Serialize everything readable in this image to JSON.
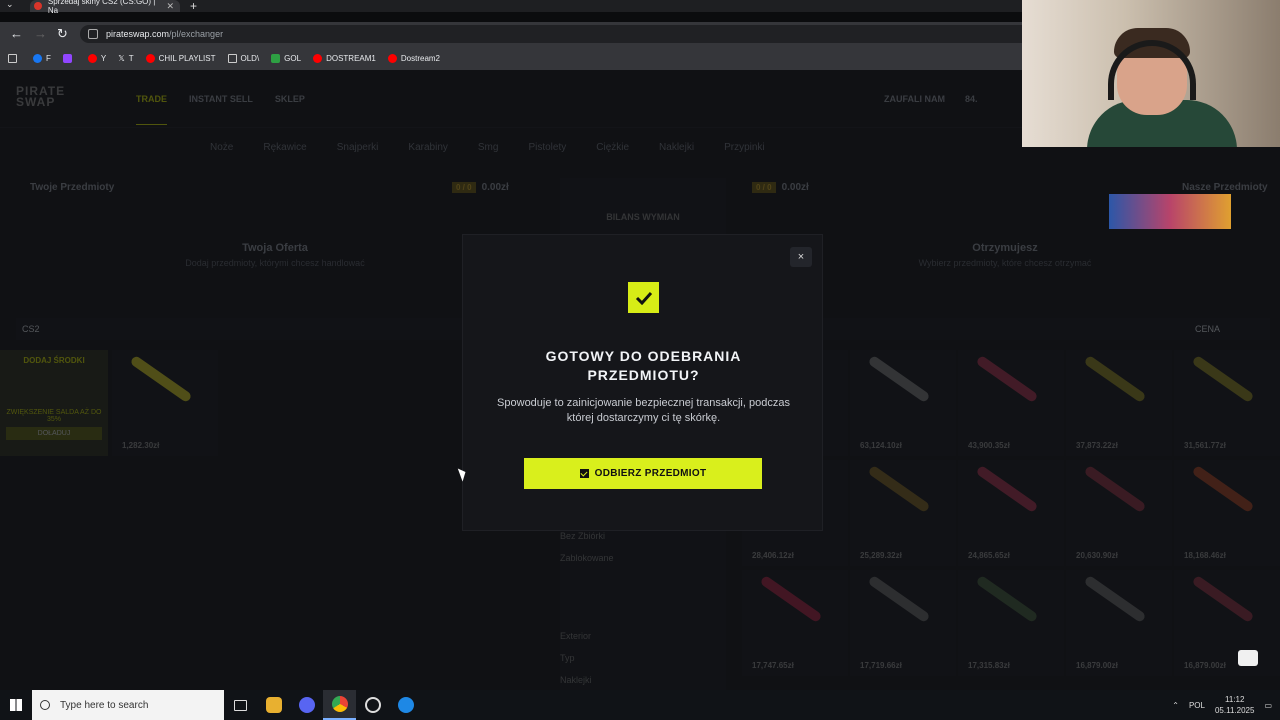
{
  "browser": {
    "tab_title": "Sprzedaj skiny CS2 (CS:GO) | Na",
    "new_tab": "+",
    "url_host": "pirateswap.com",
    "url_path": "/pl/exchanger",
    "bookmarks": [
      {
        "label": "F",
        "color": "#1877f2"
      },
      {
        "label": "",
        "color": "#9146ff"
      },
      {
        "label": "Y",
        "color": "#ff0000"
      },
      {
        "label": "T",
        "color": "#ffffff"
      },
      {
        "label": "CHIL PLAYLIST",
        "color": "#ff0000"
      },
      {
        "label": "OLD\\",
        "color": "#888888"
      },
      {
        "label": "GOL",
        "color": "#2ea043"
      },
      {
        "label": "DOSTREAM1",
        "color": "#ff0000"
      },
      {
        "label": "Dostream2",
        "color": "#ff0000"
      }
    ]
  },
  "site": {
    "logo": "PIRATE SWAP",
    "nav": [
      "TRADE",
      "INSTANT SELL",
      "SKLEP"
    ],
    "nav_right": [
      "ZAUFALI NAM",
      "84."
    ],
    "categories": [
      "Noże",
      "Rękawice",
      "Snajperki",
      "Karabiny",
      "Smg",
      "Pistolety",
      "Ciężkie",
      "Naklejki",
      "Przypinki"
    ],
    "left_header": "Twoje Przedmioty",
    "right_header": "Nasze Przedmioty",
    "counter": "0 / 0",
    "left_total": "0.00zł",
    "right_total": "0.00zł",
    "balance_title": "BILANS WYMIAN",
    "offer_title": "Twoja Oferta",
    "offer_sub": "Dodaj przedmioty, którymi chcesz handlować",
    "receive_title": "Otrzymujesz",
    "receive_sub": "Wybierz przedmioty, które chcesz otrzymać",
    "game_filter": "CS2",
    "sort_label": "CENA",
    "deposit_tile": {
      "title": "DODAJ ŚRODKI",
      "bonus": "ZWIĘKSZENIE SALDA AŻ DO 35%",
      "button": "DOŁADUJ"
    },
    "my_item_price": "1,282.30zł",
    "filters": [
      "Bez Zbiórki",
      "Zablokowane",
      "Exterior",
      "Typ",
      "Naklejki"
    ],
    "market_prices": [
      "63,124.10zł",
      "43,900.35zł",
      "37,873.22zł",
      "31,561.77zł",
      "28,406.12zł",
      "25,289.32zł",
      "24,865.65zł",
      "20,630.90zł",
      "18,168.46zł",
      "17,747.65zł",
      "17,719.66zł",
      "17,315.83zł",
      "16,879.00zł",
      "16,879.00zł"
    ]
  },
  "modal": {
    "title_line1": "GOTOWY DO ODEBRANIA",
    "title_line2": "PRZEDMIOTU?",
    "description": "Spowoduje to zainicjowanie bezpiecznej transakcji, podczas której dostarczymy ci tę skórkę.",
    "cta": "ODBIERZ PRZEDMIOT",
    "close": "×",
    "accent": "#d9ef1c"
  },
  "taskbar": {
    "search_placeholder": "Type here to search",
    "lang": "POL",
    "time": "11:12",
    "date": "05.11.2025"
  }
}
